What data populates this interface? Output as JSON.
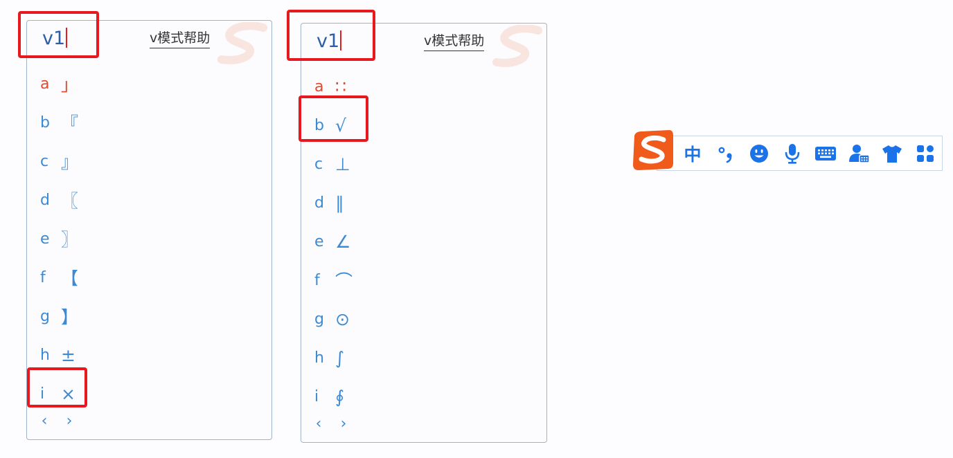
{
  "colors": {
    "accent": "#1a73e8",
    "candidate_text": "#3b8ad4",
    "highlight_text": "#e14a2c",
    "annotation_red": "#e8191e",
    "sogou_orange": "#f05a1a"
  },
  "panels": [
    {
      "composition": "v1",
      "help_label": "v模式帮助",
      "logo_icon": "sogou-logo",
      "candidates": [
        {
          "key": "a",
          "symbol": "」"
        },
        {
          "key": "b",
          "symbol": "『"
        },
        {
          "key": "c",
          "symbol": "』"
        },
        {
          "key": "d",
          "symbol": "〖"
        },
        {
          "key": "e",
          "symbol": "〗"
        },
        {
          "key": "f",
          "symbol": "【"
        },
        {
          "key": "g",
          "symbol": "】"
        },
        {
          "key": "h",
          "symbol": "±"
        },
        {
          "key": "i",
          "symbol": "×"
        }
      ],
      "pager": {
        "prev": "‹",
        "next": "›"
      }
    },
    {
      "composition": "v1",
      "help_label": "v模式帮助",
      "logo_icon": "sogou-logo",
      "candidates": [
        {
          "key": "a",
          "symbol": "∷"
        },
        {
          "key": "b",
          "symbol": "√"
        },
        {
          "key": "c",
          "symbol": "⊥"
        },
        {
          "key": "d",
          "symbol": "∥"
        },
        {
          "key": "e",
          "symbol": "∠"
        },
        {
          "key": "f",
          "symbol": "⌒"
        },
        {
          "key": "g",
          "symbol": "⊙"
        },
        {
          "key": "h",
          "symbol": "∫"
        },
        {
          "key": "i",
          "symbol": "∮"
        }
      ],
      "pager": {
        "prev": "‹",
        "next": "›"
      }
    }
  ],
  "toolbar": {
    "logo_icon": "sogou-logo",
    "mode_label": "中",
    "items": [
      "punctuation-icon",
      "emoji-icon",
      "microphone-icon",
      "keyboard-icon",
      "user-account-icon",
      "skin-shirt-icon",
      "toolbox-grid-icon"
    ]
  }
}
